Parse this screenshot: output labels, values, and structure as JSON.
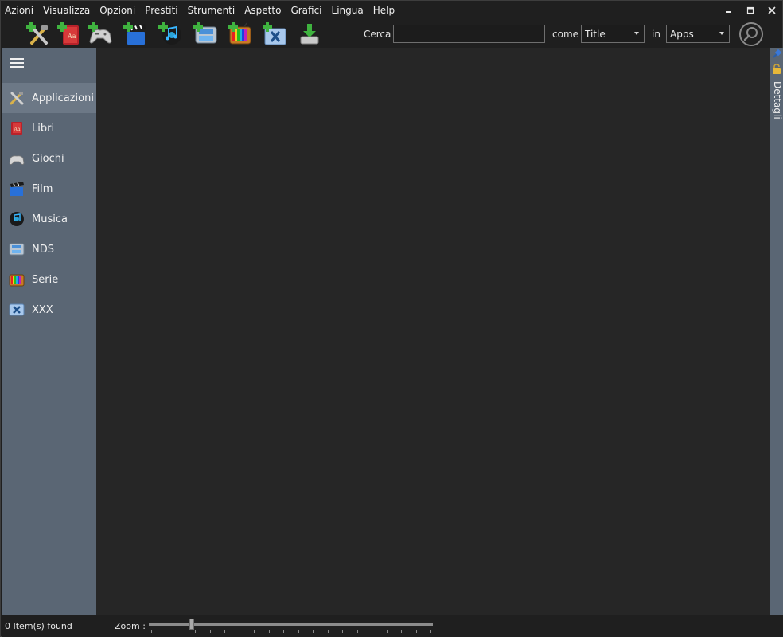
{
  "menu": [
    "Azioni",
    "Visualizza",
    "Opzioni",
    "Prestiti",
    "Strumenti",
    "Aspetto",
    "Grafici",
    "Lingua",
    "Help"
  ],
  "window_controls": {
    "minimize_icon": "minimize-icon",
    "maximize_icon": "maximize-icon",
    "close_icon": "close-icon"
  },
  "toolbar": {
    "buttons": [
      {
        "name": "add-app-button",
        "icon": "tools-add-icon"
      },
      {
        "name": "add-book-button",
        "icon": "book-add-icon"
      },
      {
        "name": "add-game-button",
        "icon": "gamepad-add-icon"
      },
      {
        "name": "add-film-button",
        "icon": "clapper-add-icon"
      },
      {
        "name": "add-music-button",
        "icon": "music-add-icon"
      },
      {
        "name": "add-nds-button",
        "icon": "nds-add-icon"
      },
      {
        "name": "add-series-button",
        "icon": "tv-add-icon"
      },
      {
        "name": "add-xxx-button",
        "icon": "xxx-add-icon"
      },
      {
        "name": "download-button",
        "icon": "download-icon"
      }
    ],
    "search_label": "Cerca",
    "search_value": "",
    "as_label": "come",
    "field_select": "Title",
    "in_label": "in",
    "category_select": "Apps",
    "search_button_icon": "magnifier-icon"
  },
  "sidebar": {
    "menu_icon": "hamburger-icon",
    "items": [
      {
        "label": "Applicazioni",
        "icon": "tools-icon",
        "active": true
      },
      {
        "label": "Libri",
        "icon": "book-icon",
        "active": false
      },
      {
        "label": "Giochi",
        "icon": "gamepad-icon",
        "active": false
      },
      {
        "label": "Film",
        "icon": "clapper-icon",
        "active": false
      },
      {
        "label": "Musica",
        "icon": "music-icon",
        "active": false
      },
      {
        "label": "NDS",
        "icon": "nds-icon",
        "active": false
      },
      {
        "label": "Serie",
        "icon": "tv-icon",
        "active": false
      },
      {
        "label": "XXX",
        "icon": "xxx-icon",
        "active": false
      }
    ]
  },
  "details_panel": {
    "label": "Dettagli",
    "pin_icon": "pin-icon",
    "lock_icon": "lock-icon"
  },
  "status": {
    "items_found": "0 Item(s) found",
    "zoom_label": "Zoom :",
    "zoom_level": 0.15
  },
  "colors": {
    "sidebar": "#5a6674",
    "content": "#262626",
    "background": "#1f1f1f"
  }
}
